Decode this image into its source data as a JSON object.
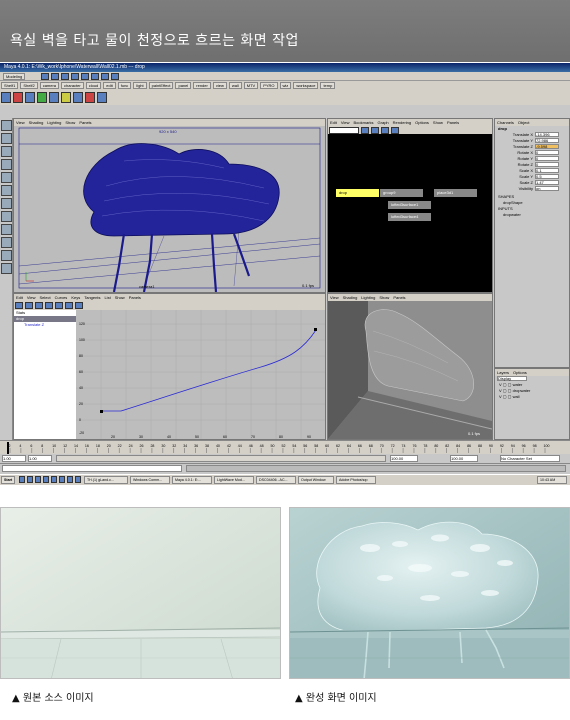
{
  "header": {
    "title": "욕실 벽을 타고 물이 천정으로 흐르는 화면 작업"
  },
  "maya": {
    "window_title": "Maya 4.0.1: E:\\Wk_work\\Iphone\\Waterwall\\Wall02.1.mb   ---   drop",
    "mode_select": "Modeling",
    "shelf_tabs": [
      "Shelf1",
      "Shelf2",
      "camera",
      "character",
      "cloud",
      "edit",
      "func",
      "light",
      "paintEffect",
      "panel",
      "render",
      "view",
      "wall",
      "MTV",
      "PYRO",
      "wiz",
      "workspace",
      "temp"
    ],
    "top_view": {
      "menu": [
        "View",
        "Shading",
        "Lighting",
        "Show",
        "Panels"
      ],
      "top_label": "920 x 540",
      "camera": "camera1",
      "fps": "0.1 fps"
    },
    "hypergraph": {
      "menu": [
        "Edit",
        "View",
        "Bookmarks",
        "Graph",
        "Rendering",
        "Options",
        "Show",
        "Panels"
      ],
      "nodes": [
        "drop",
        "group9",
        "place3d1",
        "lofted3surface1",
        "lofted3surface4"
      ]
    },
    "graph_editor": {
      "menu": [
        "Edit",
        "View",
        "Select",
        "Curves",
        "Keys",
        "Tangents",
        "List",
        "Show",
        "Panels"
      ],
      "outliner_items": [
        "Stats",
        "Translate Z"
      ],
      "y_ticks": [
        "120",
        "100",
        "80",
        "60",
        "40",
        "20",
        "0",
        "-20"
      ],
      "x_ticks": [
        "20",
        "30",
        "40",
        "50",
        "60",
        "70",
        "80",
        "90"
      ]
    },
    "persp_view": {
      "menu": [
        "View",
        "Shading",
        "Lighting",
        "Show",
        "Panels"
      ],
      "fps": "0.1 fps"
    },
    "channel_box": {
      "tabs": [
        "Channels",
        "Object"
      ],
      "node": "drop",
      "rows": [
        {
          "label": "Translate X",
          "value": "-14.396"
        },
        {
          "label": "Translate Y",
          "value": "72.986"
        },
        {
          "label": "Translate Z",
          "value": "-9.598"
        },
        {
          "label": "Rotate X",
          "value": "0"
        },
        {
          "label": "Rotate Y",
          "value": "0"
        },
        {
          "label": "Rotate Z",
          "value": "0"
        },
        {
          "label": "Scale X",
          "value": "0.1"
        },
        {
          "label": "Scale Y",
          "value": "0.5"
        },
        {
          "label": "Scale Z",
          "value": "1.47"
        },
        {
          "label": "Visibility",
          "value": "on"
        }
      ],
      "shapes_label": "SHAPES",
      "shape": "dropShape",
      "inputs_label": "INPUTS",
      "input": "dropwater"
    },
    "layers": {
      "tabs": [
        "Layers",
        "Options"
      ],
      "display": "Display",
      "items": [
        "water",
        "dropwater",
        "wall"
      ]
    },
    "timeline_ticks": [
      "2",
      "4",
      "6",
      "8",
      "10",
      "12",
      "14",
      "16",
      "18",
      "20",
      "22",
      "24",
      "26",
      "28",
      "30",
      "32",
      "34",
      "36",
      "38",
      "40",
      "42",
      "44",
      "46",
      "48",
      "50",
      "52",
      "54",
      "56",
      "58",
      "60",
      "62",
      "64",
      "66",
      "68",
      "70",
      "72",
      "74",
      "76",
      "78",
      "80",
      "82",
      "84",
      "86",
      "88",
      "90",
      "92",
      "94",
      "96",
      "98",
      "100"
    ],
    "range": {
      "start": "1.00",
      "start2": "1.00",
      "end": "100.00",
      "end2": "100.00",
      "charset": "No Character Set"
    },
    "taskbar": {
      "start": "Start",
      "tasks": [
        "TH.(1) gLand.c...",
        "Windows Comm...",
        "Maya 4.0.1: E:...",
        "LightWave Mod...",
        "DSC04406 - AC...",
        "Output Window",
        "Adobe Photoshop"
      ],
      "clock": "10:43 AM"
    }
  },
  "captions": {
    "left": "▲ 원본 소스 이미지",
    "right": "▲ 완성 화면 이미지"
  },
  "colors": {
    "header_bg": "#737373",
    "mesh": "#1a1a8c",
    "maya_gray": "#c8c8c8"
  }
}
